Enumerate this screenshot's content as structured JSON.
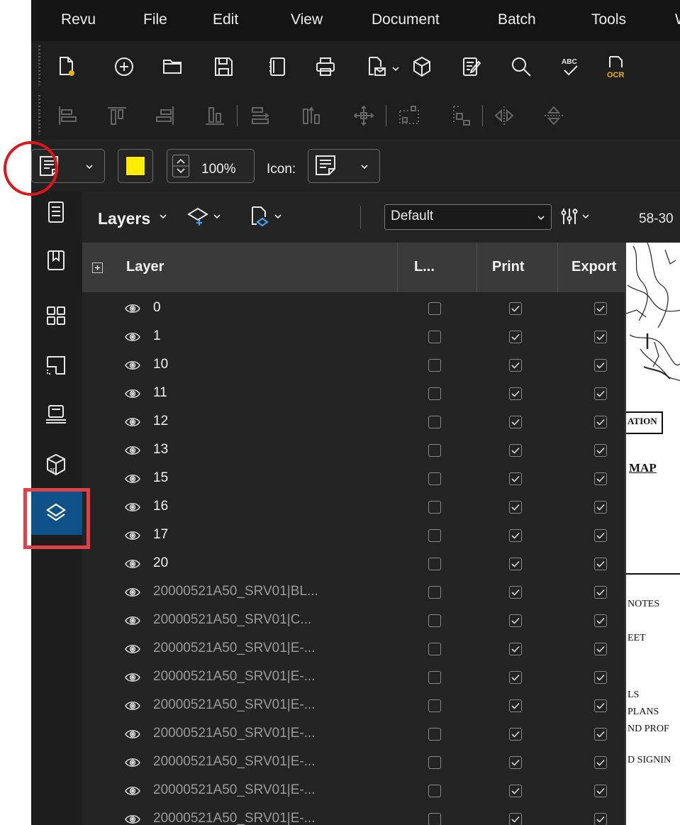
{
  "menu": [
    "Revu",
    "File",
    "Edit",
    "View",
    "Document",
    "Batch",
    "Tools",
    "W"
  ],
  "toolbar_top": {
    "icons": [
      "new-document-icon",
      "plus-circle-icon",
      "open-folder-icon",
      "save-icon",
      "bookmark-book-icon",
      "print-icon",
      "email-document-icon",
      "cube-3d-icon",
      "edit-document-icon",
      "search-icon",
      "spellcheck-icon",
      "ocr-icon"
    ],
    "spellcheck_text": "ABC",
    "ocr_text": "OCR"
  },
  "toolbar_align": {
    "icons": [
      "align-left-icon",
      "align-top-icon",
      "align-right-icon",
      "align-bottom-icon",
      "distribute-horizontal-icon",
      "distribute-vertical-icon",
      "move-icon",
      "group-icon",
      "ungroup-icon",
      "flip-horizontal-icon",
      "flip-vertical-icon"
    ]
  },
  "properties_bar": {
    "zoom": "100%",
    "icon_label": "Icon:",
    "fill_color": "#ffee00"
  },
  "siderail": {
    "icons": [
      "properties-panel-icon",
      "bookmarks-icon",
      "thumbnails-icon",
      "spaces-icon",
      "studio-icon",
      "3d-model-icon",
      "layers-icon"
    ],
    "active": "layers-icon",
    "accent": "#0f5289"
  },
  "layers_panel": {
    "title": "Layers",
    "view": "Default",
    "columns": [
      "Layer",
      "L...",
      "Print",
      "Export"
    ],
    "rows": [
      {
        "name": "0",
        "dim": false
      },
      {
        "name": "1",
        "dim": false
      },
      {
        "name": "10",
        "dim": false
      },
      {
        "name": "11",
        "dim": false
      },
      {
        "name": "12",
        "dim": false
      },
      {
        "name": "13",
        "dim": false
      },
      {
        "name": "15",
        "dim": false
      },
      {
        "name": "16",
        "dim": false
      },
      {
        "name": "17",
        "dim": false
      },
      {
        "name": "20",
        "dim": false
      },
      {
        "name": "20000521A50_SRV01|BL...",
        "dim": true
      },
      {
        "name": "20000521A50_SRV01|C...",
        "dim": true
      },
      {
        "name": "20000521A50_SRV01|E-...",
        "dim": true
      },
      {
        "name": "20000521A50_SRV01|E-...",
        "dim": true
      },
      {
        "name": "20000521A50_SRV01|E-...",
        "dim": true
      },
      {
        "name": "20000521A50_SRV01|E-...",
        "dim": true
      },
      {
        "name": "20000521A50_SRV01|E-...",
        "dim": true
      },
      {
        "name": "20000521A50_SRV01|E-...",
        "dim": true
      },
      {
        "name": "20000521A50_SRV01|E-...",
        "dim": true
      }
    ],
    "locked_checked": false,
    "print_checked": true,
    "export_checked": true
  },
  "document": {
    "tab_label": "58-30",
    "text": [
      "ATION",
      "MAP",
      "NOTES",
      "EET",
      "LS",
      "PLANS",
      "ND PROF",
      "D SIGNIN"
    ]
  },
  "annotation_color": "#e0141b"
}
